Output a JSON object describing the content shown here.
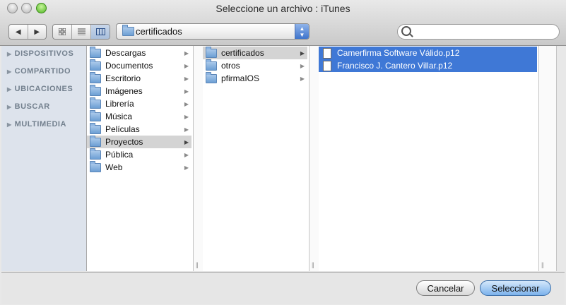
{
  "window": {
    "title": "Seleccione un archivo : iTunes"
  },
  "toolbar": {
    "back_icon": "◀",
    "forward_icon": "▶",
    "view_icons": [
      "icon-view-icon",
      "list-view-icon",
      "column-view-icon"
    ],
    "location": "certificados",
    "search_placeholder": ""
  },
  "sidebar": {
    "sections": [
      {
        "label": "DISPOSITIVOS"
      },
      {
        "label": "COMPARTIDO"
      },
      {
        "label": "UBICACIONES"
      },
      {
        "label": "BUSCAR"
      },
      {
        "label": "MULTIMEDIA"
      }
    ]
  },
  "columns": {
    "col1": [
      {
        "label": "Descargas"
      },
      {
        "label": "Documentos"
      },
      {
        "label": "Escritorio"
      },
      {
        "label": "Imágenes"
      },
      {
        "label": "Librería"
      },
      {
        "label": "Música"
      },
      {
        "label": "Películas"
      },
      {
        "label": "Proyectos"
      },
      {
        "label": "Pública"
      },
      {
        "label": "Web"
      }
    ],
    "col2": [
      {
        "label": "certificados"
      },
      {
        "label": "otros"
      },
      {
        "label": "pfirmaIOS"
      }
    ],
    "col3": [
      {
        "label": "Camerfirma Software Válido.p12"
      },
      {
        "label": "Francisco J. Cantero Villar.p12"
      }
    ]
  },
  "buttons": {
    "cancel": "Cancelar",
    "select": "Seleccionar"
  },
  "colors": {
    "selection_blue": "#3f78d6",
    "sidebar_bg": "#dde3ec"
  }
}
